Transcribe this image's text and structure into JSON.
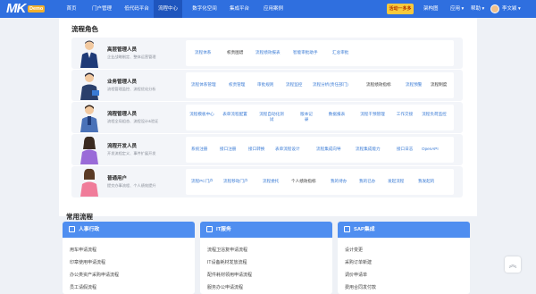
{
  "app": {
    "logo_text": "MK",
    "logo_badge": "Demo"
  },
  "nav": {
    "items": [
      {
        "label": "首页"
      },
      {
        "label": "门户管理"
      },
      {
        "label": "低代码平台"
      },
      {
        "label": "流程中心"
      },
      {
        "label": "数字化空间"
      },
      {
        "label": "集成平台"
      },
      {
        "label": "应用案例"
      }
    ],
    "active_index": 3,
    "promo_label": "活动一多多",
    "right": {
      "schema": "架构图",
      "apps": "应用 ▾",
      "help": "帮助 ▾",
      "user": "李文颖 ▾"
    }
  },
  "roles_section": {
    "title": "流程角色",
    "roles": [
      {
        "name": "高层管理人员",
        "desc": "企业战略制定、整体运营管理",
        "links": [
          "流程体系",
          "权责图谱",
          "流程绩效报表",
          "智能审批助手",
          "汇总审批"
        ]
      },
      {
        "name": "业务管理人员",
        "desc": "流程管理监控、流程优化分析",
        "links": [
          "流程体系管理",
          "权责管理",
          "审批规则",
          "流程监控",
          "流程分析(责任部门)",
          "流程绩效指标",
          "流程预警",
          "流程制度"
        ]
      },
      {
        "name": "流程管理人员",
        "desc": "流程全局组态、流程设计&验证",
        "links": [
          "流程模板中心",
          "表单流程配置",
          "流程自动化测试",
          "版本记录",
          "数据报表",
          "流程干预管理",
          "工作交接",
          "流程负荷监控"
        ]
      },
      {
        "name": "流程开发人员",
        "desc": "开发流程定义、事件扩展开发",
        "links": [
          "系统注册",
          "接口注册",
          "接口转换",
          "表单流程设计",
          "流程集成向导",
          "流程集成能力",
          "接口日志",
          "OpenAPI"
        ]
      },
      {
        "name": "普通用户",
        "desc": "提交办事流程、个人绩效提升",
        "links": [
          "流程PC门户",
          "流程移动门户",
          "流程委托",
          "个人绩效指标",
          "我的待办",
          "我的已办",
          "发起流程",
          "我发起的"
        ]
      }
    ]
  },
  "common_section": {
    "title": "常用流程",
    "categories": [
      {
        "title": "人事行政",
        "items": [
          "用车申请流程",
          "印章使用申请流程",
          "办公类资产采购申请流程",
          "员工请假流程"
        ]
      },
      {
        "title": "IT服务",
        "items": [
          "流程卫浴复申请流程",
          "IT设备耗材发放流程",
          "配件耗材领用申请流程",
          "服务办公申请流程"
        ]
      },
      {
        "title": "SAP集成",
        "items": [
          "设计变更",
          "采购订单新建",
          "调价申请单",
          "费用合同发付款"
        ]
      }
    ]
  },
  "float": {
    "back_to_top_glyph": "︽"
  },
  "colors": {
    "topbar": "#2f6fdf",
    "active_nav": "#1f55bd",
    "link": "#3a7bd5",
    "card_header": "#4f8ef0"
  }
}
